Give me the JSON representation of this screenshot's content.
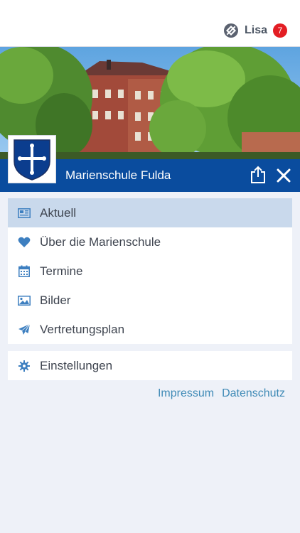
{
  "user": {
    "name": "Lisa",
    "notification_count": "7"
  },
  "school": {
    "name": "Marienschule Fulda"
  },
  "menu": {
    "items": [
      {
        "label": "Aktuell",
        "icon": "newspaper-icon",
        "active": true
      },
      {
        "label": "Über die Marienschule",
        "icon": "heart-icon",
        "active": false
      },
      {
        "label": "Termine",
        "icon": "calendar-icon",
        "active": false
      },
      {
        "label": "Bilder",
        "icon": "image-icon",
        "active": false
      },
      {
        "label": "Vertretungsplan",
        "icon": "paper-plane-icon",
        "active": false
      }
    ],
    "settings": {
      "label": "Einstellungen",
      "icon": "gear-icon"
    }
  },
  "footer": {
    "impressum": "Impressum",
    "datenschutz": "Datenschutz"
  },
  "colors": {
    "brand_blue": "#0a4c9e",
    "active_item": "#c9d9ec",
    "icon_blue": "#3d7fc0",
    "link": "#3f8ab6",
    "badge": "#e31e24",
    "background": "#eef1f8"
  }
}
